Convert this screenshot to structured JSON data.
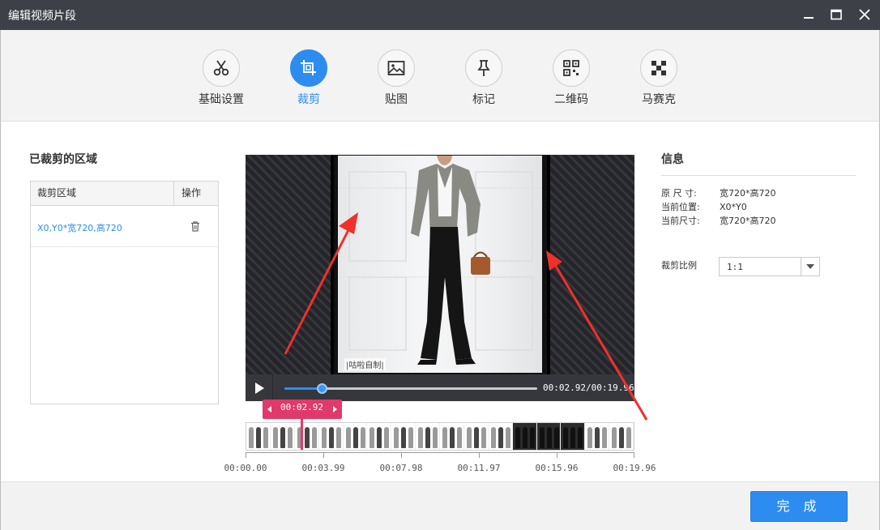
{
  "window": {
    "title": "编辑视频片段"
  },
  "tabs": [
    {
      "label": "基础设置",
      "icon": "scissors-icon"
    },
    {
      "label": "裁剪",
      "icon": "crop-icon",
      "active": true
    },
    {
      "label": "贴图",
      "icon": "image-icon"
    },
    {
      "label": "标记",
      "icon": "pin-icon"
    },
    {
      "label": "二维码",
      "icon": "qrcode-icon"
    },
    {
      "label": "马赛克",
      "icon": "mosaic-icon"
    }
  ],
  "cropped_panel": {
    "title": "已裁剪的区域",
    "col_region": "裁剪区域",
    "col_action": "操作",
    "rows": [
      {
        "region": "X0,Y0*宽720,高720",
        "action_icon": "trash-icon"
      }
    ]
  },
  "preview": {
    "watermark": "|咕啦自制|"
  },
  "player": {
    "time": "00:02.92/00:19.96",
    "progress": 0.146,
    "marker_time": "00:02.92"
  },
  "timeline": {
    "ticks": [
      "00:00.00",
      "00:03.99",
      "00:07.98",
      "00:11.97",
      "00:15.96",
      "00:19.96"
    ]
  },
  "info": {
    "title": "信息",
    "original_size_label": "原 尺 寸:",
    "original_size_value": "宽720*高720",
    "current_pos_label": "当前位置:",
    "current_pos_value": "X0*Y0",
    "current_size_label": "当前尺寸:",
    "current_size_value": "宽720*高720",
    "ratio_label": "裁剪比例",
    "ratio_value": "1:1"
  },
  "footer": {
    "done_label": "完 成"
  },
  "colors": {
    "accent": "#2d8cf0",
    "marker": "#e03a6a",
    "annotation": "#f0302a"
  }
}
